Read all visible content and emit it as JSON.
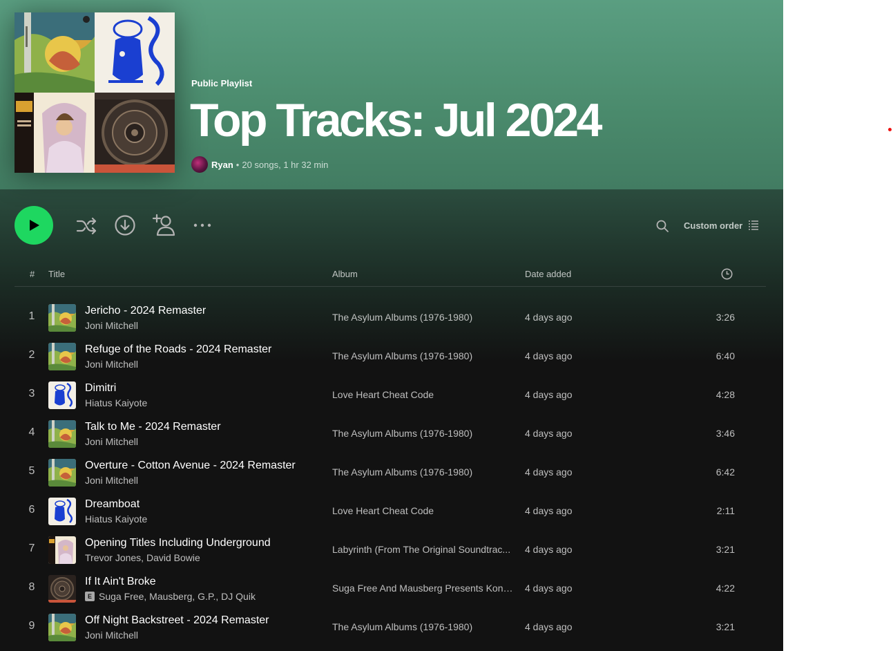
{
  "playlist": {
    "type_label": "Public Playlist",
    "title": "Top Tracks: Jul 2024",
    "owner": "Ryan",
    "separator": "•",
    "summary": "20 songs, 1 hr 32 min"
  },
  "controls": {
    "play": "play-icon",
    "shuffle": "shuffle-icon",
    "download": "download-icon",
    "add_user": "add-user-icon",
    "more": "more-icon",
    "search": "search-icon",
    "sort_label": "Custom order",
    "sort_icon": "list-icon"
  },
  "table": {
    "col_num": "#",
    "col_title": "Title",
    "col_album": "Album",
    "col_date": "Date added",
    "col_duration_icon": "clock-icon"
  },
  "tracks": [
    {
      "num": "1",
      "title": "Jericho - 2024 Remaster",
      "artist": "Joni Mitchell",
      "explicit": false,
      "album": "The Asylum Albums (1976-1980)",
      "date": "4 days ago",
      "duration": "3:26",
      "art": "asylum"
    },
    {
      "num": "2",
      "title": "Refuge of the Roads - 2024 Remaster",
      "artist": "Joni Mitchell",
      "explicit": false,
      "album": "The Asylum Albums (1976-1980)",
      "date": "4 days ago",
      "duration": "6:40",
      "art": "asylum"
    },
    {
      "num": "3",
      "title": "Dimitri",
      "artist": "Hiatus Kaiyote",
      "explicit": false,
      "album": "Love Heart Cheat Code",
      "date": "4 days ago",
      "duration": "4:28",
      "art": "loveheart"
    },
    {
      "num": "4",
      "title": "Talk to Me - 2024 Remaster",
      "artist": "Joni Mitchell",
      "explicit": false,
      "album": "The Asylum Albums (1976-1980)",
      "date": "4 days ago",
      "duration": "3:46",
      "art": "asylum"
    },
    {
      "num": "5",
      "title": "Overture - Cotton Avenue - 2024 Remaster",
      "artist": "Joni Mitchell",
      "explicit": false,
      "album": "The Asylum Albums (1976-1980)",
      "date": "4 days ago",
      "duration": "6:42",
      "art": "asylum"
    },
    {
      "num": "6",
      "title": "Dreamboat",
      "artist": "Hiatus Kaiyote",
      "explicit": false,
      "album": "Love Heart Cheat Code",
      "date": "4 days ago",
      "duration": "2:11",
      "art": "loveheart"
    },
    {
      "num": "7",
      "title": "Opening Titles Including Underground",
      "artist": "Trevor Jones, David Bowie",
      "explicit": false,
      "album": "Labyrinth (From The Original Soundtrac...",
      "date": "4 days ago",
      "duration": "3:21",
      "art": "labyrinth"
    },
    {
      "num": "8",
      "title": "If It Ain't Broke",
      "artist": "Suga Free, Mausberg, G.P., DJ Quik",
      "explicit": true,
      "explicit_label": "E",
      "album": "Suga Free And Mausberg Presents Konn...",
      "date": "4 days ago",
      "duration": "4:22",
      "art": "konnected"
    },
    {
      "num": "9",
      "title": "Off Night Backstreet - 2024 Remaster",
      "artist": "Joni Mitchell",
      "explicit": false,
      "album": "The Asylum Albums (1976-1980)",
      "date": "4 days ago",
      "duration": "3:21",
      "art": "asylum"
    }
  ],
  "colors": {
    "header_top": "#5a9e81",
    "accent_green": "#1ed760",
    "background": "#121212"
  }
}
